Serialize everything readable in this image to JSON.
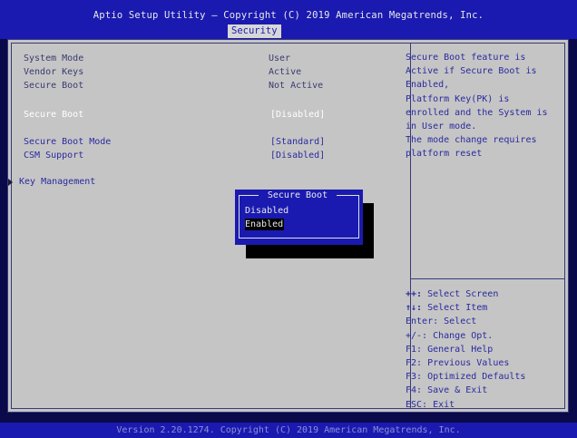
{
  "header": {
    "title": "Aptio Setup Utility – Copyright (C) 2019 American Megatrends, Inc.",
    "active_tab": "Security"
  },
  "main": {
    "info_rows": [
      {
        "label": "System Mode",
        "value": "User"
      },
      {
        "label": "Vendor Keys",
        "value": "Active"
      },
      {
        "label": "Secure Boot",
        "value": "Not Active"
      }
    ],
    "settings": [
      {
        "label": "Secure Boot",
        "value": "[Disabled]"
      },
      {
        "label": "Secure Boot Mode",
        "value": "[Standard]"
      },
      {
        "label": "CSM Support",
        "value": "[Disabled]"
      }
    ],
    "submenu_label": "Key Management"
  },
  "help_lines": [
    "Secure Boot feature is",
    "Active if Secure Boot is",
    "Enabled,",
    "Platform Key(PK) is",
    "enrolled and the System is",
    "in User mode.",
    "The mode change requires",
    "platform reset"
  ],
  "keys_help": [
    {
      "key": "++:",
      "desc": " Select Screen"
    },
    {
      "key": "↑↓:",
      "desc": " Select Item"
    },
    {
      "key": "",
      "desc": "Enter: Select"
    },
    {
      "key": "",
      "desc": "+/-: Change Opt."
    },
    {
      "key": "",
      "desc": "F1: General Help"
    },
    {
      "key": "",
      "desc": "F2: Previous Values"
    },
    {
      "key": "",
      "desc": "F3: Optimized Defaults"
    },
    {
      "key": "",
      "desc": "F4: Save & Exit"
    },
    {
      "key": "",
      "desc": "ESC: Exit"
    }
  ],
  "dialog": {
    "title": "Secure Boot",
    "options": [
      "Disabled",
      "Enabled"
    ],
    "selected": "Enabled"
  },
  "footer": {
    "text": "Version 2.20.1274. Copyright (C) 2019 American Megatrends, Inc."
  }
}
